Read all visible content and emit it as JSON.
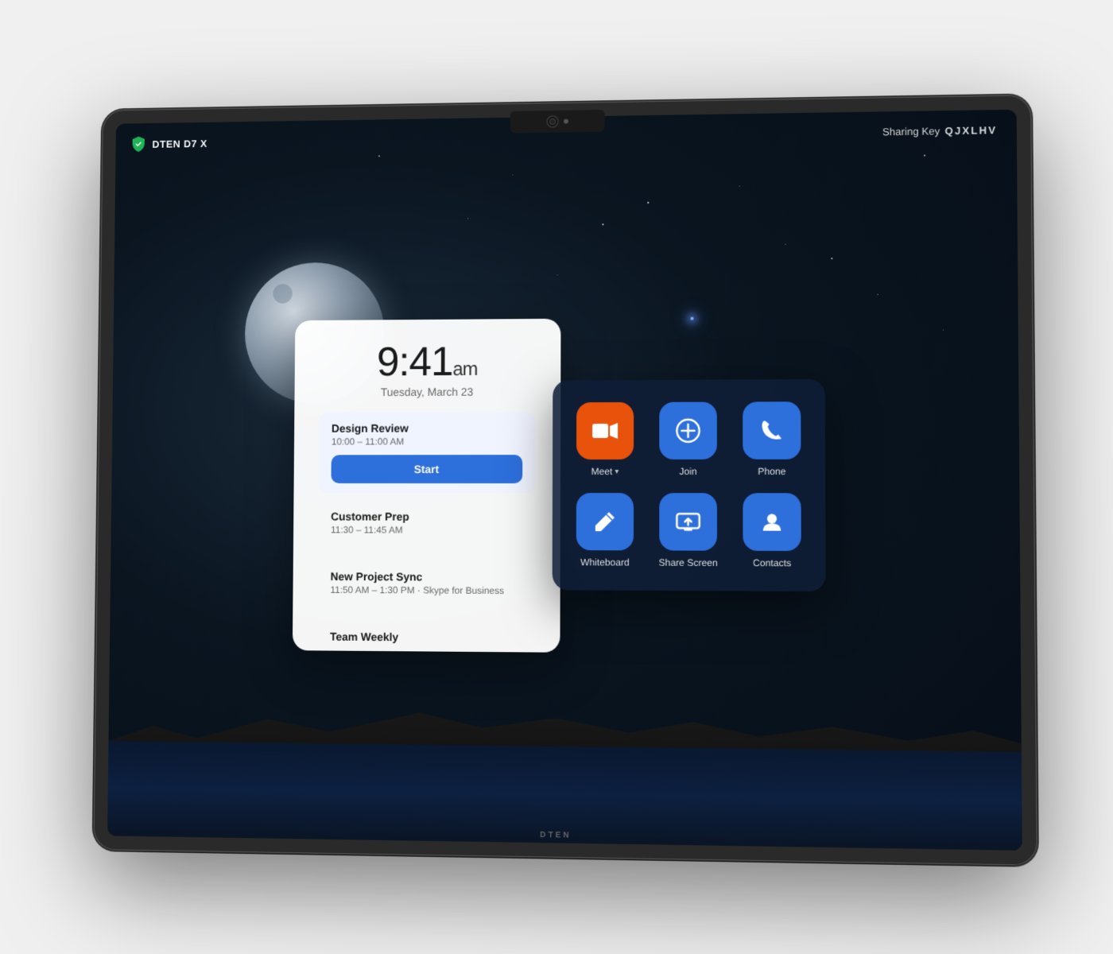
{
  "device": {
    "brand": "DTEN",
    "model": "DTEN D7 X",
    "brand_label": "DTEN"
  },
  "sharing": {
    "label": "Sharing Key",
    "key": "QJXLHV"
  },
  "clock": {
    "time": "9:41",
    "ampm": "am",
    "date": "Tuesday, March 23"
  },
  "meetings": [
    {
      "title": "Design Review",
      "time": "10:00 – 11:00 AM",
      "highlighted": true,
      "has_button": true,
      "button_label": "Start"
    },
    {
      "title": "Customer Prep",
      "time": "11:30 – 11:45 AM",
      "highlighted": false,
      "has_button": false
    },
    {
      "title": "New Project Sync",
      "time": "11:50 AM – 1:30 PM · Skype for Business",
      "highlighted": false,
      "has_button": false
    },
    {
      "title": "Team Weekly",
      "time": "",
      "highlighted": false,
      "has_button": false,
      "partial": true
    }
  ],
  "apps": [
    {
      "id": "meet",
      "label": "Meet",
      "has_chevron": true,
      "color": "orange",
      "icon": "video-camera"
    },
    {
      "id": "join",
      "label": "Join",
      "has_chevron": false,
      "color": "blue",
      "icon": "plus-circle"
    },
    {
      "id": "phone",
      "label": "Phone",
      "has_chevron": false,
      "color": "blue",
      "icon": "phone"
    },
    {
      "id": "whiteboard",
      "label": "Whiteboard",
      "has_chevron": false,
      "color": "blue",
      "icon": "pencil"
    },
    {
      "id": "share-screen",
      "label": "Share Screen",
      "has_chevron": false,
      "color": "blue",
      "icon": "share-screen"
    },
    {
      "id": "contacts",
      "label": "Contacts",
      "has_chevron": false,
      "color": "blue",
      "icon": "person"
    }
  ],
  "colors": {
    "orange": "#e8520a",
    "blue": "#2d6fdb",
    "bg_panel": "rgba(15,30,55,0.88)"
  }
}
